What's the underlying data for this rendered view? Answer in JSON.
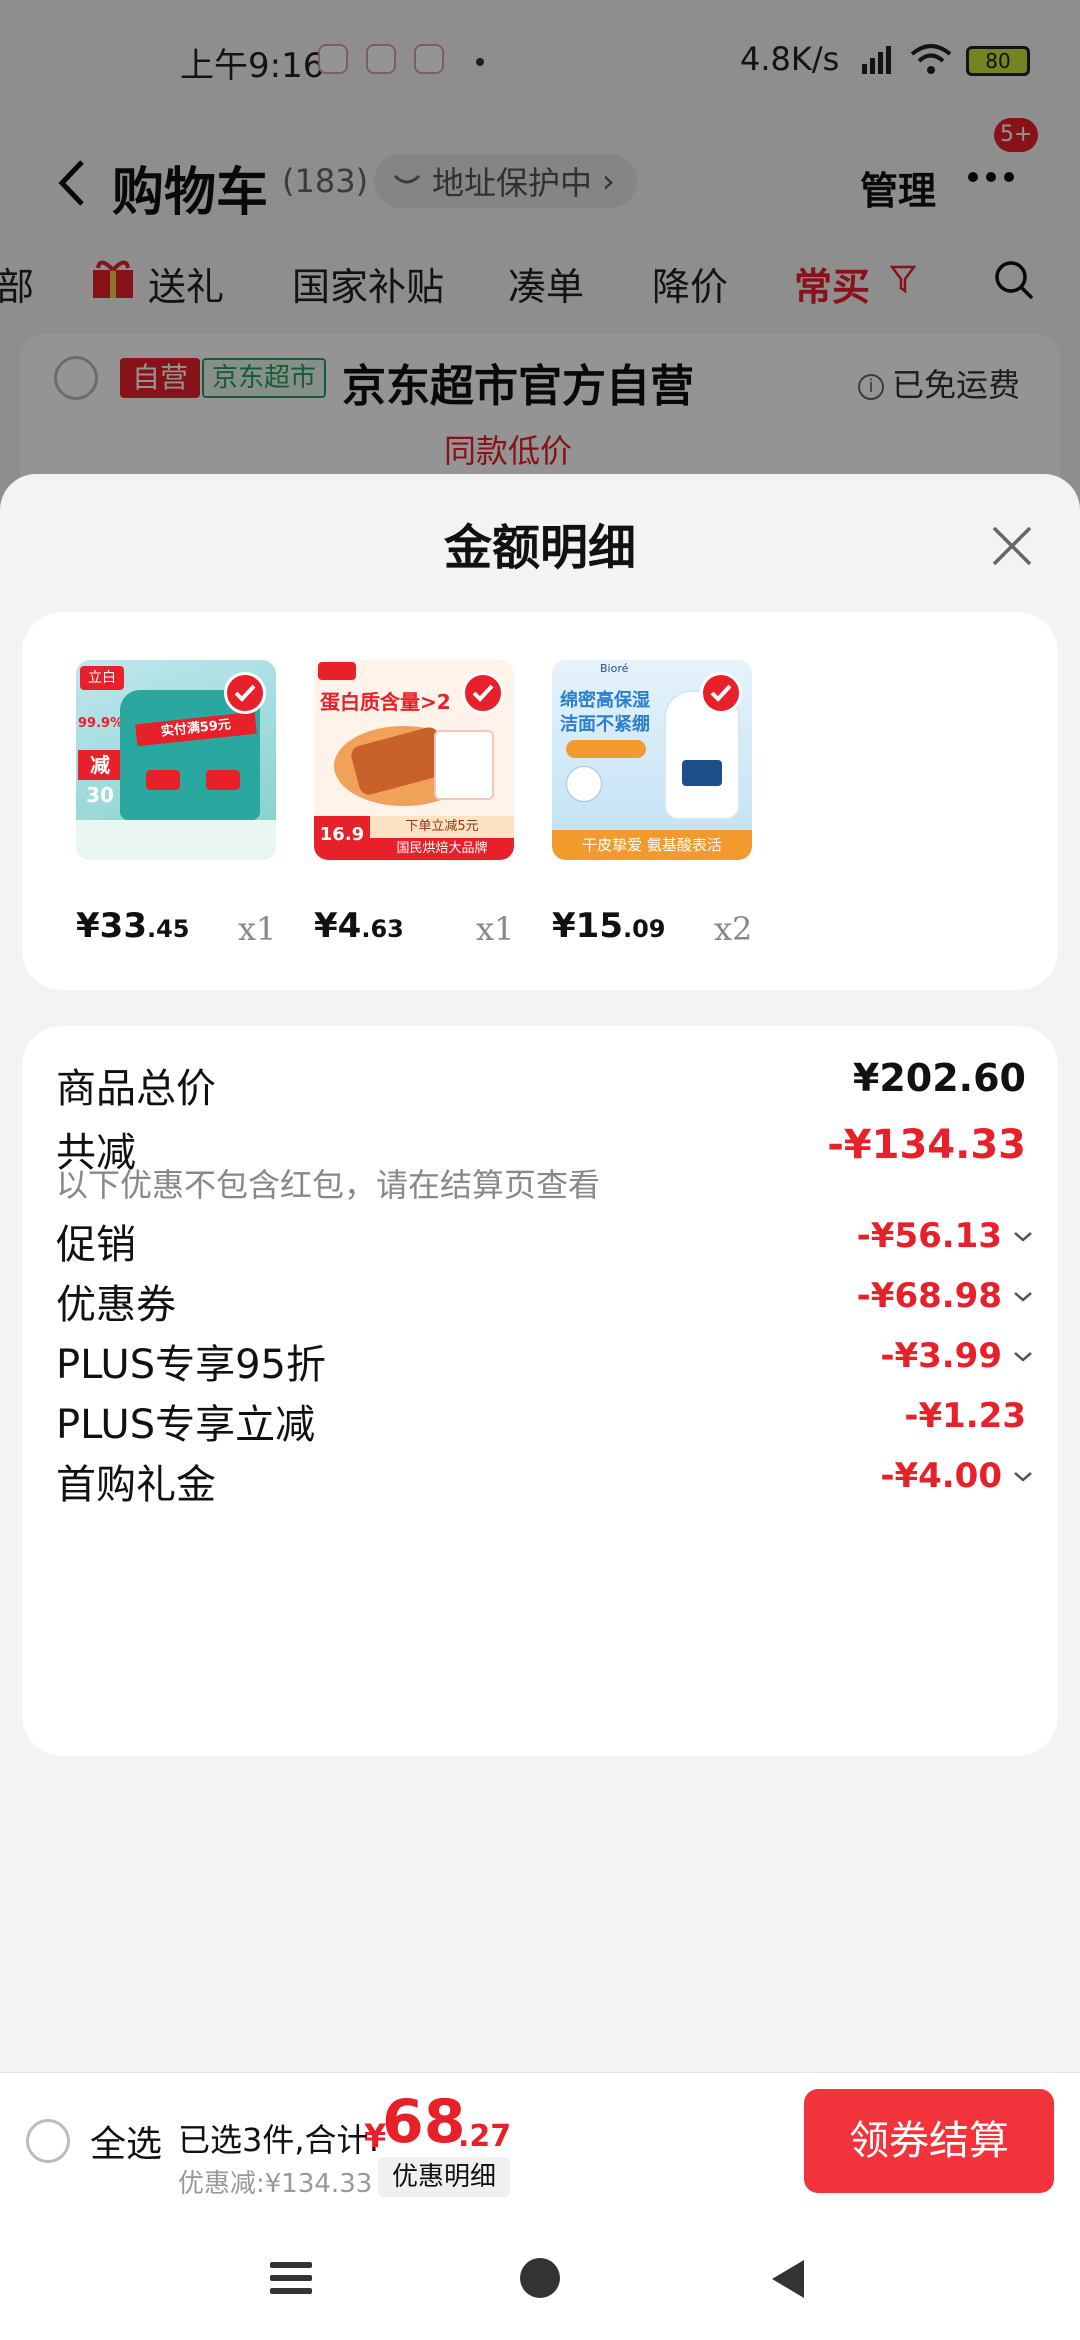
{
  "status_bar": {
    "time": "上午9:16",
    "speed": "4.8K/s",
    "battery": "80"
  },
  "header": {
    "title": "购物车",
    "count": "(183)",
    "address_protect": "地址保护中",
    "manage": "管理",
    "badge": "5+"
  },
  "filter_tabs": [
    {
      "label": "部"
    },
    {
      "label": "送礼"
    },
    {
      "label": "国家补贴"
    },
    {
      "label": "凑单"
    },
    {
      "label": "降价"
    },
    {
      "label": "常买"
    }
  ],
  "store": {
    "tag_self": "自营",
    "tag_market": "京东超市",
    "name": "京东超市官方自营",
    "shipping": "已免运费",
    "low_price": "同款低价"
  },
  "sheet": {
    "title": "金额明细",
    "products": [
      {
        "price_int": "¥33",
        "price_dec": ".45",
        "qty": "x1",
        "image_text_1": "实付满59元",
        "image_text_2": "减30",
        "image_text_3": "99.9%"
      },
      {
        "price_int": "¥4",
        "price_dec": ".63",
        "qty": "x1",
        "image_text_1": "蛋白质含量>2",
        "image_text_2": "16.9",
        "image_text_3": "下单立减5元",
        "image_text_4": "国民烘焙大品牌"
      },
      {
        "price_int": "¥15",
        "price_dec": ".09",
        "qty": "x2",
        "image_text_1": "绵密高保湿",
        "image_text_2": "洁面不紧绷",
        "image_text_3": "干皮挚爱 氨基酸表活",
        "image_text_4": "Bioré"
      }
    ],
    "summary": {
      "total_label": "商品总价",
      "total_value": "¥202.60",
      "reduce_label": "共减",
      "reduce_value": "-¥134.33",
      "reduce_note": "以下优惠不包含红包，请在结算页查看",
      "items": [
        {
          "label": "促销",
          "value": "-¥56.13",
          "has_chevron": true
        },
        {
          "label": "优惠券",
          "value": "-¥68.98",
          "has_chevron": true
        },
        {
          "label": "PLUS专享95折",
          "value": "-¥3.99",
          "has_chevron": true
        },
        {
          "label": "PLUS专享立减",
          "value": "-¥1.23",
          "has_chevron": false
        },
        {
          "label": "首购礼金",
          "value": "-¥4.00",
          "has_chevron": true
        }
      ]
    }
  },
  "bottom_bar": {
    "select_all": "全选",
    "selected_summary": "已选3件,合计:",
    "total_currency": "¥",
    "total_int": "68",
    "total_dec": ".27",
    "discount_line": "优惠减:¥134.33",
    "detail_button": "优惠明细",
    "checkout_button": "领券结算"
  },
  "colors": {
    "accent_red": "#e8202a",
    "checkout_red": "#f2333c",
    "green_tag": "#23a058"
  }
}
